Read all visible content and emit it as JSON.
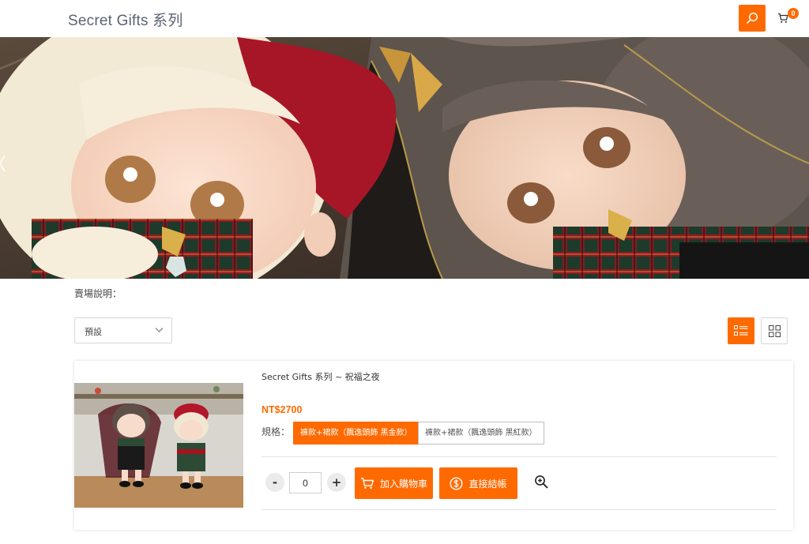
{
  "header": {
    "brand": "Secret Gifts 系列",
    "cart_count": "0"
  },
  "listing": {
    "description_label": "賣場說明：",
    "sort": {
      "selected": "預設"
    }
  },
  "product": {
    "name": "Secret Gifts 系列 ~ 祝福之夜",
    "price": "NT$2700",
    "spec_label": "規格：",
    "specs": [
      {
        "label": "褲款+裙款（飄逸頭飾 黑金款）",
        "selected": true
      },
      {
        "label": "褲款+裙款（飄逸頭飾 黑紅款）",
        "selected": false
      }
    ],
    "quantity": "0",
    "qty_minus": "-",
    "qty_plus": "+",
    "add_to_cart": "加入購物車",
    "checkout": "直接結帳"
  },
  "colors": {
    "accent": "#ff6a00"
  },
  "icons": [
    "search-icon",
    "cart-icon",
    "chevron-down-icon",
    "list-view-icon",
    "grid-view-icon",
    "cart-icon",
    "dollar-coin-icon",
    "zoom-in-icon"
  ]
}
